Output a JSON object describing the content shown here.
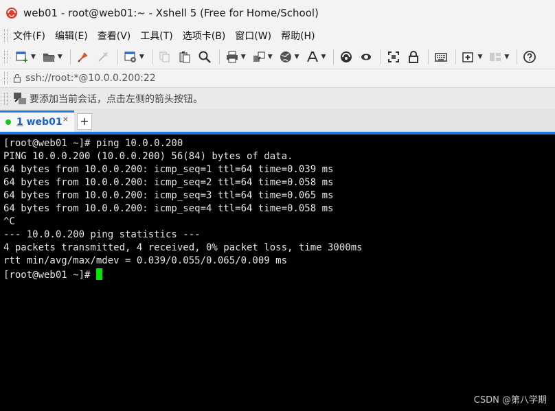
{
  "window": {
    "title": "web01 - root@web01:~ - Xshell 5 (Free for Home/School)"
  },
  "menu": [
    "文件(F)",
    "编辑(E)",
    "查看(V)",
    "工具(T)",
    "选项卡(B)",
    "窗口(W)",
    "帮助(H)"
  ],
  "toolbar": {
    "icons": [
      "new-session-icon",
      "open-folder-icon",
      "reconnect-icon",
      "disconnect-icon",
      "properties-icon",
      "copy-icon",
      "paste-icon",
      "find-icon",
      "print-icon",
      "transfer-icon",
      "globe-icon",
      "font-icon",
      "xftp-icon",
      "xagent-icon",
      "fullscreen-icon",
      "lock-icon",
      "keyboard-icon",
      "new-tab-icon",
      "layout-icon",
      "help-icon"
    ]
  },
  "address": {
    "value": "ssh://root:*@10.0.0.200:22"
  },
  "hint": {
    "text": "要添加当前会话，点击左侧的箭头按钮。"
  },
  "tabs": [
    {
      "number": "1",
      "label": "web01",
      "close": "×",
      "status_color": "#19c51d"
    }
  ],
  "tab_add_label": "+",
  "terminal": {
    "lines": [
      "[root@web01 ~]# ping 10.0.0.200",
      "PING 10.0.0.200 (10.0.0.200) 56(84) bytes of data.",
      "64 bytes from 10.0.0.200: icmp_seq=1 ttl=64 time=0.039 ms",
      "64 bytes from 10.0.0.200: icmp_seq=2 ttl=64 time=0.058 ms",
      "64 bytes from 10.0.0.200: icmp_seq=3 ttl=64 time=0.065 ms",
      "64 bytes from 10.0.0.200: icmp_seq=4 ttl=64 time=0.058 ms",
      "^C",
      "--- 10.0.0.200 ping statistics ---",
      "4 packets transmitted, 4 received, 0% packet loss, time 3000ms",
      "rtt min/avg/max/mdev = 0.039/0.055/0.065/0.009 ms"
    ],
    "prompt": "[root@web01 ~]# ",
    "cursor_color": "#00e600"
  },
  "watermark": "CSDN @第八学期",
  "colors": {
    "accent": "#1e7ae0",
    "terminal_bg": "#000000",
    "terminal_fg": "#e6e6e6"
  }
}
